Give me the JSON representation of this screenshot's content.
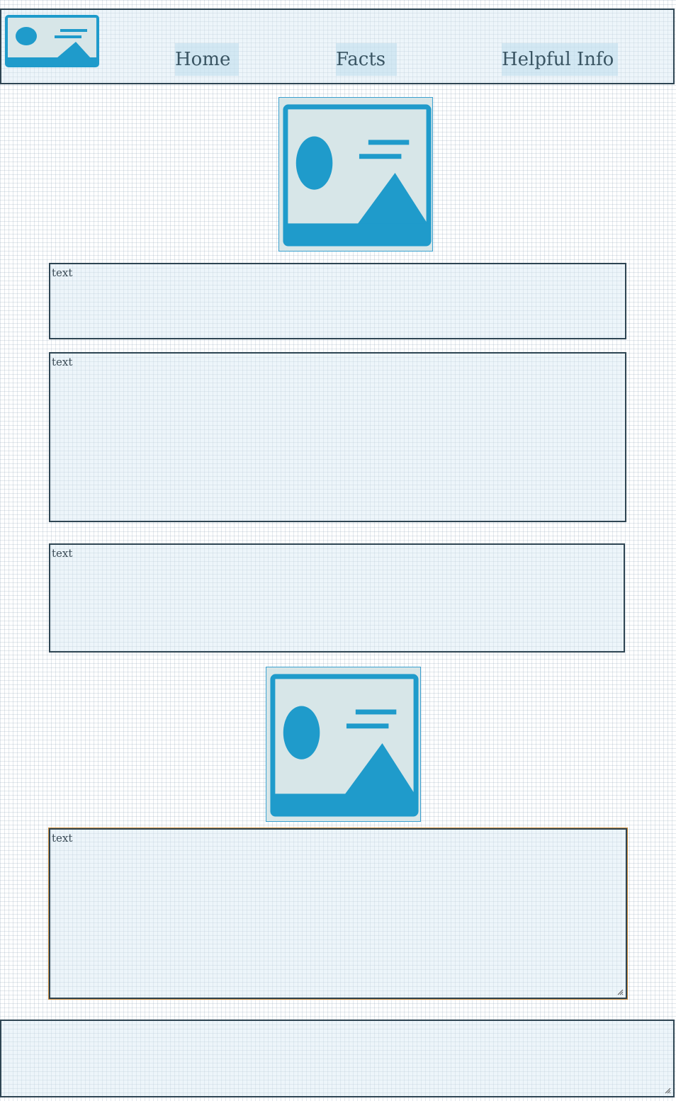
{
  "header": {
    "logo_icon": "image-placeholder-icon",
    "nav": [
      {
        "label": "Home"
      },
      {
        "label": "Facts"
      },
      {
        "label": "Helpful Info"
      }
    ]
  },
  "main": {
    "hero_image_icon": "image-placeholder-icon",
    "text_boxes": [
      {
        "text": "text"
      },
      {
        "text": "text"
      },
      {
        "text": "text"
      }
    ],
    "second_image_icon": "image-placeholder-icon",
    "text_area": {
      "text": "text"
    }
  },
  "colors": {
    "accent": "#1f9bcb",
    "image_bg": "#d7e6e8",
    "border": "#2e4553",
    "panel_bg": "#e4f0f7",
    "focus_border": "#c98a3a"
  }
}
